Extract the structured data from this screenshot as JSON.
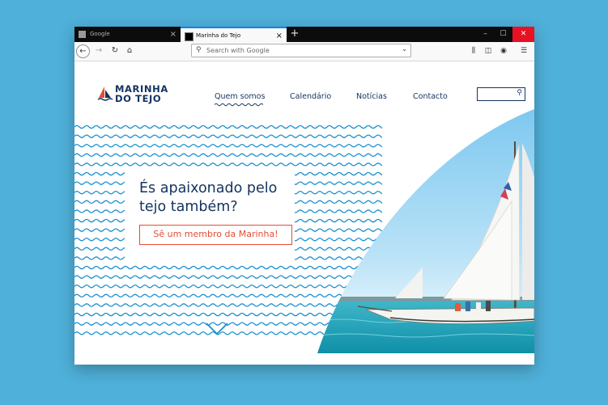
{
  "browser": {
    "tabs": [
      {
        "title": "Google",
        "close": "×"
      },
      {
        "title": "Marinha do Tejo",
        "close": "×"
      }
    ],
    "new_tab": "+",
    "window_controls": {
      "minimize": "–",
      "maximize": "☐",
      "close": "✕"
    },
    "address_placeholder": "Search with Google"
  },
  "site": {
    "logo_line1": "MARINHA",
    "logo_line2": "DO TEJO",
    "nav": [
      "Quem somos",
      "Calendário",
      "Notícias",
      "Contacto"
    ],
    "active_nav": "Quem somos",
    "hero_title_line1": "És apaixonado pelo",
    "hero_title_line2": "tejo também?",
    "cta_label": "Sê um membro da Marinha!"
  },
  "colors": {
    "brand_navy": "#13335f",
    "accent_red": "#e44d33",
    "wave_blue": "#1a8fcf",
    "desktop_bg": "#4fb0d9"
  }
}
